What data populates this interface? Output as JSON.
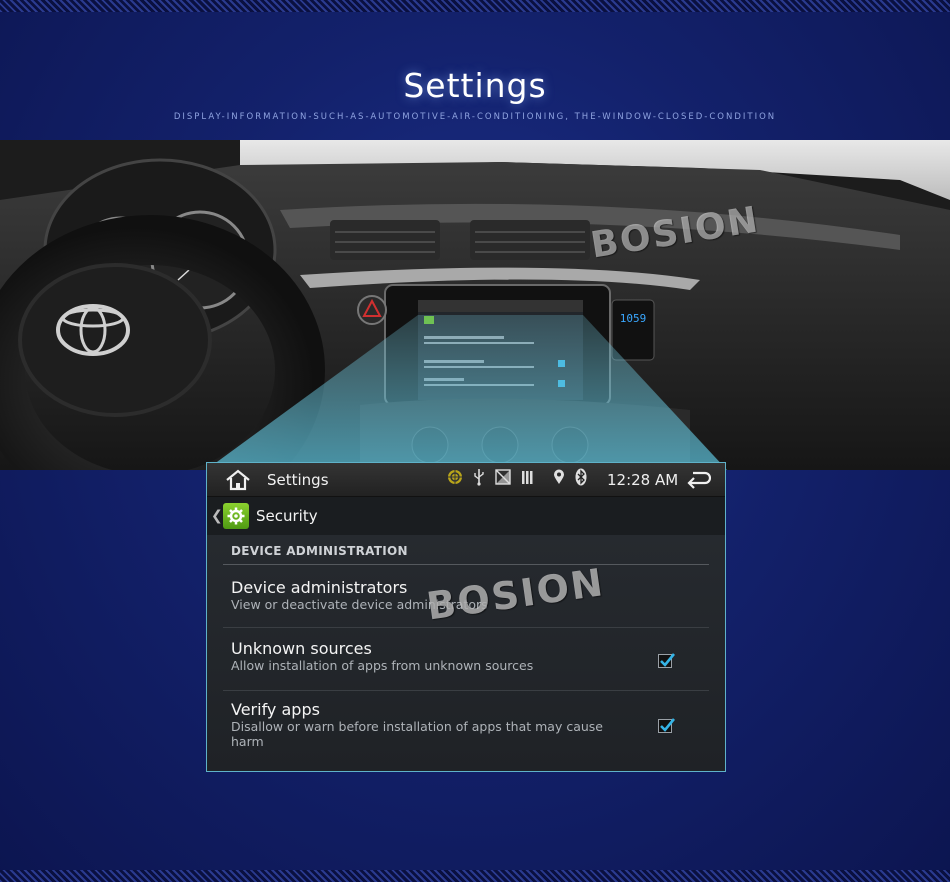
{
  "banner": {
    "title": "Settings",
    "subtitle": "DISPLAY-INFORMATION-SUCH-AS-AUTOMOTIVE-AIR-CONDITIONING, THE-WINDOW-CLOSED-CONDITION"
  },
  "watermark": "BOSION",
  "car_photo": {
    "clock_display": "1059",
    "mini_screen": {
      "title": "Settings",
      "section": "Security",
      "items": [
        "Device administrators",
        "Unknown sources",
        "Verify apps"
      ]
    }
  },
  "statusbar": {
    "title": "Settings",
    "time": "12:28 AM",
    "icons": [
      "android-debug-icon",
      "usb-icon",
      "no-signal-icon",
      "signal-bars-icon",
      "location-icon",
      "bluetooth-icon"
    ]
  },
  "actionbar": {
    "title": "Security",
    "icon": "settings-gear-icon"
  },
  "section": {
    "header": "DEVICE ADMINISTRATION"
  },
  "prefs": [
    {
      "title": "Device administrators",
      "summary": "View or deactivate device administrators",
      "checkbox": false
    },
    {
      "title": "Unknown sources",
      "summary": "Allow installation of apps from unknown sources",
      "checkbox": true,
      "checked": true
    },
    {
      "title": "Verify apps",
      "summary": "Disallow or warn before installation of apps that may cause harm",
      "checkbox": true,
      "checked": true
    }
  ],
  "colors": {
    "background": "#13216b",
    "accent_check": "#35b4e6",
    "app_icon": "#6cbf21"
  }
}
